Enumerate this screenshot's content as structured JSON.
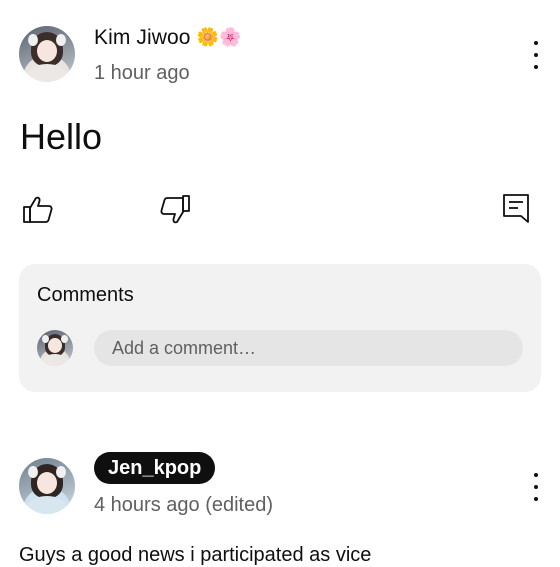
{
  "post": {
    "author": "Kim Jiwoo",
    "author_emojis": "🌼🌸",
    "time": "1 hour ago",
    "body": "Hello",
    "actions": {
      "like_icon": "thumbs-up-icon",
      "dislike_icon": "thumbs-down-icon",
      "comment_icon": "comment-icon"
    }
  },
  "comments": {
    "title": "Comments",
    "placeholder": "Add a comment…"
  },
  "next_post": {
    "author": "Jen_kpop",
    "time": "4 hours ago (edited)",
    "body": "Guys a good news i participated as vice"
  },
  "colors": {
    "secondary_text": "#606060",
    "card_background": "#f2f2f2",
    "input_background": "#e5e5e5",
    "badge_background": "#0f0f0f"
  }
}
